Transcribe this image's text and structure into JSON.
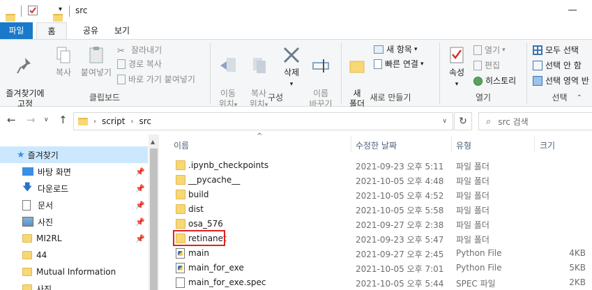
{
  "window": {
    "title": "src"
  },
  "tabs": [
    {
      "label": "파일"
    },
    {
      "label": "홈"
    },
    {
      "label": "공유"
    },
    {
      "label": "보기"
    }
  ],
  "ribbon": {
    "clipboard": {
      "label": "클립보드",
      "pin": "즐겨찾기에\n고정",
      "copy": "복사",
      "paste": "붙여넣기",
      "cut": "잘라내기",
      "copy_path": "경로 복사",
      "paste_shortcut": "바로 가기 붙여넣기"
    },
    "organize": {
      "label": "구성",
      "move_to": "이동\n위치",
      "copy_to": "복사\n위치",
      "delete": "삭제",
      "rename": "이름\n바꾸기"
    },
    "new": {
      "label": "새로 만들기",
      "new_folder": "새\n폴더",
      "new_item": "새 항목",
      "easy_access": "빠른 연결"
    },
    "open": {
      "label": "열기",
      "properties": "속성",
      "open": "열기",
      "edit": "편집",
      "history": "히스토리"
    },
    "select": {
      "label": "선택",
      "select_all": "모두 선택",
      "select_none": "선택 안 함",
      "invert": "선택 영역 반"
    }
  },
  "address": {
    "crumbs": [
      "script",
      "src"
    ],
    "search_placeholder": "src 검색"
  },
  "nav": [
    {
      "label": "즐겨찾기",
      "icon": "star-icon",
      "pinned": false,
      "selected": true
    },
    {
      "label": "바탕 화면",
      "icon": "desktop-icon",
      "pinned": true
    },
    {
      "label": "다운로드",
      "icon": "download-icon",
      "pinned": true
    },
    {
      "label": "문서",
      "icon": "document-icon",
      "pinned": true
    },
    {
      "label": "사진",
      "icon": "pictures-icon",
      "pinned": true
    },
    {
      "label": "MI2RL",
      "icon": "folder-icon",
      "pinned": true
    },
    {
      "label": "44",
      "icon": "folder-icon",
      "pinned": false
    },
    {
      "label": "Mutual Information",
      "icon": "folder-icon",
      "pinned": false
    },
    {
      "label": "사진",
      "icon": "folder-icon",
      "pinned": false
    }
  ],
  "columns": {
    "name": "이름",
    "date": "수정한 날짜",
    "type": "유형",
    "size": "크기"
  },
  "files": [
    {
      "name": ".ipynb_checkpoints",
      "date": "2021-09-23 오후 5:11",
      "type": "파일 폴더",
      "size": "",
      "icon": "folder-icon"
    },
    {
      "name": "__pycache__",
      "date": "2021-10-05 오후 4:48",
      "type": "파일 폴더",
      "size": "",
      "icon": "folder-icon"
    },
    {
      "name": "build",
      "date": "2021-10-05 오후 4:52",
      "type": "파일 폴더",
      "size": "",
      "icon": "folder-icon"
    },
    {
      "name": "dist",
      "date": "2021-10-05 오후 5:58",
      "type": "파일 폴더",
      "size": "",
      "icon": "folder-icon"
    },
    {
      "name": "osa_576",
      "date": "2021-09-27 오후 2:38",
      "type": "파일 폴더",
      "size": "",
      "icon": "folder-icon"
    },
    {
      "name": "retinanet",
      "date": "2021-09-23 오후 5:47",
      "type": "파일 폴더",
      "size": "",
      "icon": "folder-icon"
    },
    {
      "name": "main",
      "date": "2021-09-27 오후 2:45",
      "type": "Python File",
      "size": "4KB",
      "icon": "python-file-icon"
    },
    {
      "name": "main_for_exe",
      "date": "2021-10-05 오후 7:01",
      "type": "Python File",
      "size": "5KB",
      "icon": "python-file-icon"
    },
    {
      "name": "main_for_exe.spec",
      "date": "2021-10-05 오후 5:44",
      "type": "SPEC 파일",
      "size": "2KB",
      "icon": "spec-file-icon"
    }
  ],
  "colors": {
    "accent": "#1979ca",
    "selection": "#cce8ff",
    "highlight_box": "#e02020",
    "folder": "#f8d775"
  }
}
